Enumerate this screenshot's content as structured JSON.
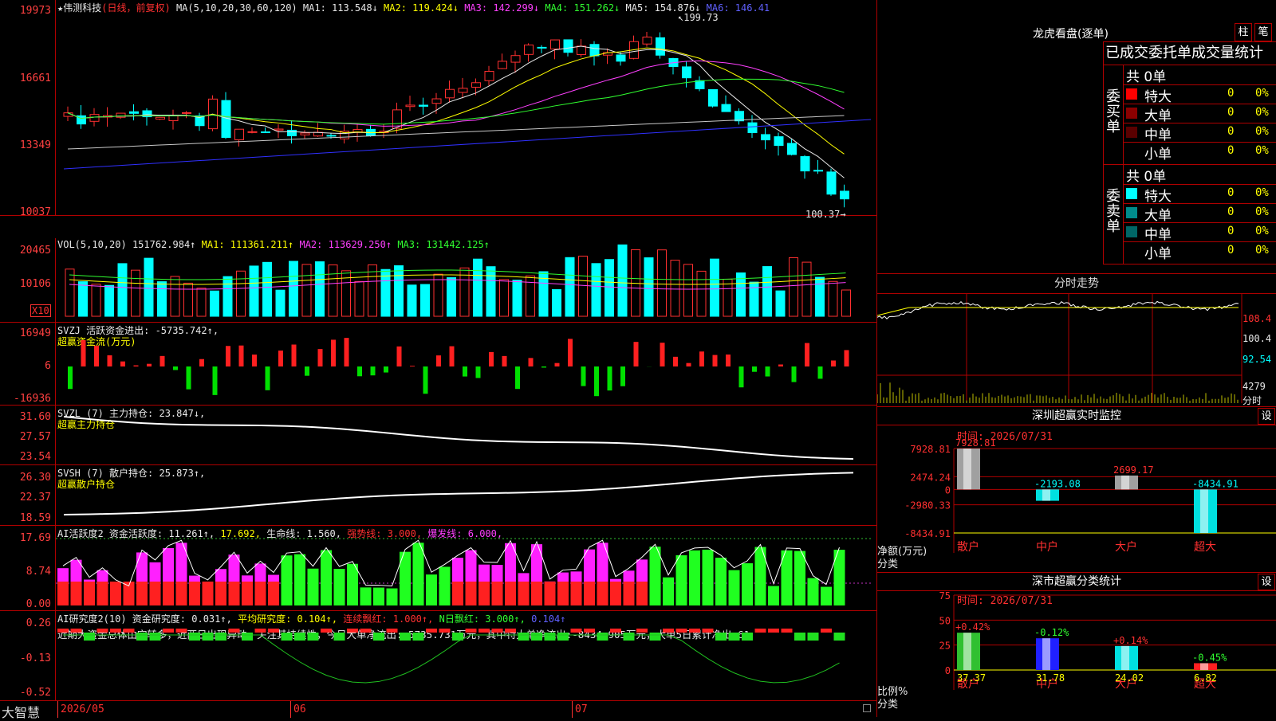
{
  "stock": {
    "name": "伟测科技",
    "period": "(日线，前复权)",
    "star": "★"
  },
  "ma_header": {
    "label": "MA(5,10,20,30,60,120)",
    "ma1": "MA1: 113.548↓",
    "ma2": "MA2: 119.424↓",
    "ma3": "MA3: 142.299↓",
    "ma4": "MA4: 151.262↓",
    "ma5": "MA5: 154.876↓",
    "ma6": "MA6: 146.41"
  },
  "price_axis": [
    "19973",
    "16661",
    "13349",
    "10037"
  ],
  "price_annotations": {
    "high": "199.73",
    "low": "100.37"
  },
  "vol_header": {
    "label": "VOL(5,10,20)",
    "value": "151762.984↑",
    "ma1": "MA1: 111361.211↑",
    "ma2": "MA2: 113629.250↑",
    "ma3": "MA3: 131442.125↑"
  },
  "vol_axis": [
    "20465",
    "10106"
  ],
  "vol_unit": "X10",
  "svzj": {
    "line1": "SVZJ  活跃资金进出: -5735.742↑,",
    "line2": "超赢资金流(万元)",
    "axis": [
      "16949",
      "6",
      "-16936"
    ]
  },
  "svzl": {
    "line1": "SVZL (7) 主力持仓: 23.847↓,",
    "line2": "超赢主力持仓",
    "axis": [
      "31.60",
      "27.57",
      "23.54"
    ]
  },
  "svsh": {
    "line1": "SVSH (7) 散户持仓: 25.873↑,",
    "line2": "超赢散户持仓",
    "axis": [
      "26.30",
      "22.37",
      "18.59"
    ]
  },
  "ai1": {
    "p1": "AI活跃度2 资金活跃度: 11.261↑,",
    "p2": "17.692,",
    "p3": "生命线: 1.560,",
    "p4": "强势线: 3.000,",
    "p5": "爆发线: 6.000,",
    "axis": [
      "17.69",
      "8.74",
      "0.00"
    ]
  },
  "ai2": {
    "p1": "AI研究度2(10) 资金研究度: 0.031↑,",
    "p2": "平均研究度: 0.104↑,",
    "p3": "连续飘红: 1.000↑,",
    "p4": "N日飘红: 3.000↑,",
    "p5": "0.104↑",
    "axis": [
      "0.26",
      "-0.13",
      "-0.52"
    ],
    "comment": "近期大资金总体由空转多，近两日出现异动，关注其持续性，今日大单净流出:-5735.731万元，其中特大单净流出:-8434.905万元，大单5日累计净出-61"
  },
  "bottom": {
    "brand": "大智慧",
    "d1": "2026/05",
    "d2": "06",
    "d3": "07"
  },
  "lhb": {
    "title": "龙虎看盘(逐单)",
    "btn1": "柱",
    "btn2": "笔",
    "subtitle": "已成交委托单成交量统计",
    "buy": {
      "side": "委买单",
      "total": "共 0单",
      "rows": [
        {
          "name": "特大",
          "n": "0",
          "p": "0%",
          "color": "#ff0000"
        },
        {
          "name": "大单",
          "n": "0",
          "p": "0%",
          "color": "#8b0000"
        },
        {
          "name": "中单",
          "n": "0",
          "p": "0%",
          "color": "#5a0000"
        },
        {
          "name": "小单",
          "n": "0",
          "p": "0%",
          "color": ""
        }
      ]
    },
    "sell": {
      "side": "委卖单",
      "total": "共 0单",
      "rows": [
        {
          "name": "特大",
          "n": "0",
          "p": "0%",
          "color": "#00ffff"
        },
        {
          "name": "大单",
          "n": "0",
          "p": "0%",
          "color": "#008b8b"
        },
        {
          "name": "中单",
          "n": "0",
          "p": "0%",
          "color": "#006666"
        },
        {
          "name": "小单",
          "n": "0",
          "p": "0%",
          "color": ""
        }
      ]
    }
  },
  "intraday": {
    "title": "分时走势",
    "axis": [
      "108.4",
      "100.4",
      "92.54",
      "4279",
      "分时"
    ]
  },
  "sz_monitor": {
    "title": "深圳超赢实时监控",
    "btn": "设",
    "time": "时间: 2026/07/31",
    "axis": [
      "7928.81",
      "2474.24",
      "0",
      "-2980.33",
      "-8434.91"
    ],
    "ylabel1": "净额(万元)",
    "ylabel2": "分类",
    "chart_data": {
      "type": "bar",
      "categories": [
        "散户",
        "中户",
        "大户",
        "超大"
      ],
      "values": [
        7928.81,
        -2193.08,
        2699.17,
        -8434.91
      ],
      "labels": [
        "7928.81",
        "-2193.08",
        "2699.17",
        "-8434.91"
      ],
      "ylim": [
        -8434.91,
        7928.81
      ]
    }
  },
  "sz_class": {
    "title": "深市超赢分类统计",
    "btn": "设",
    "time": "时间: 2026/07/31",
    "axis": [
      "75",
      "50",
      "25",
      "0"
    ],
    "ylabel1": "比例%",
    "ylabel2": "分类",
    "chart_data": {
      "type": "bar",
      "categories": [
        "散户",
        "中户",
        "大户",
        "超大"
      ],
      "values": [
        37.37,
        31.78,
        24.02,
        6.82
      ],
      "changes": [
        "+0.42%",
        "-0.12%",
        "+0.14%",
        "-0.45%"
      ],
      "ylim": [
        0,
        75
      ]
    }
  }
}
